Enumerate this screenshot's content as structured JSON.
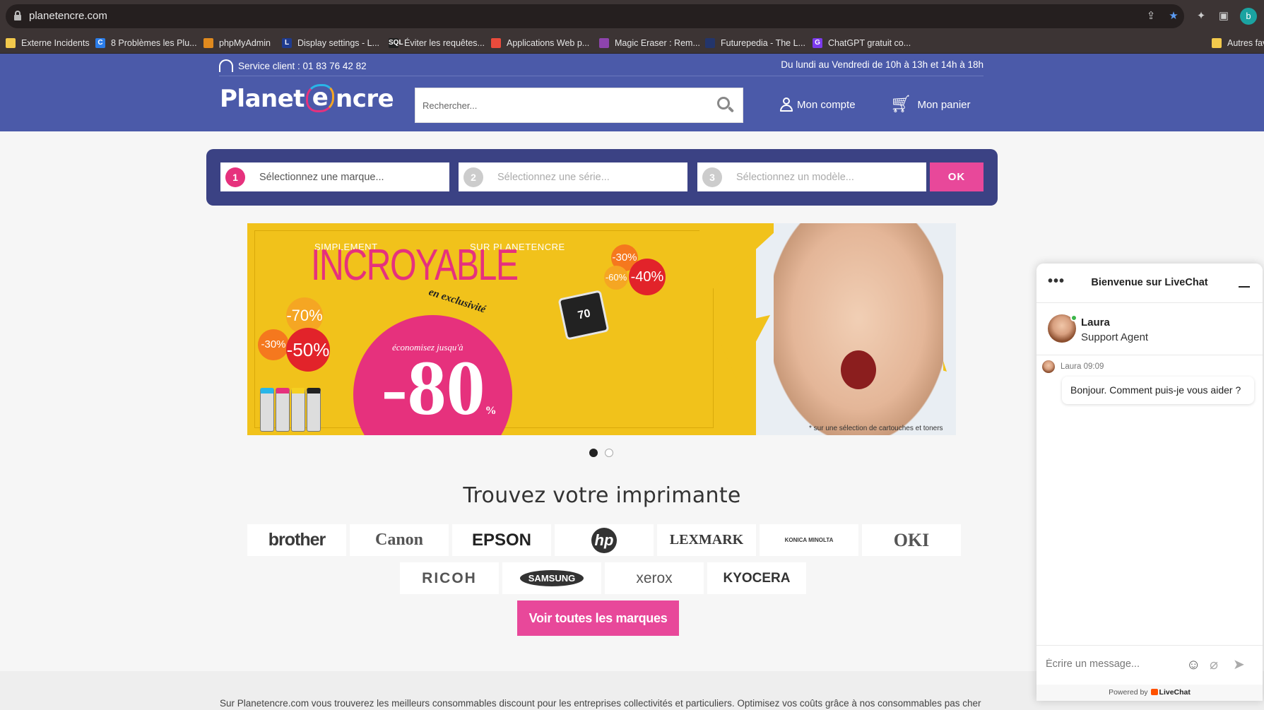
{
  "browser": {
    "url": "planetencre.com",
    "profile_initial": "b",
    "bookmarks": [
      {
        "label": "Externe Incidents",
        "color": "#f2c94c"
      },
      {
        "label": "8 Problèmes les Plu...",
        "color": "#2b7de9"
      },
      {
        "label": "phpMyAdmin",
        "color": "#e08a1e"
      },
      {
        "label": "Display settings - L...",
        "color": "#1f3b8f"
      },
      {
        "label": "Éviter les requêtes...",
        "color": "#222222"
      },
      {
        "label": "Applications Web p...",
        "color": "#e94b3c"
      },
      {
        "label": "Magic Eraser : Rem...",
        "color": "#8e44ad"
      },
      {
        "label": "Futurepedia - The L...",
        "color": "#23356b"
      },
      {
        "label": "ChatGPT gratuit co...",
        "color": "#7c3aed"
      },
      {
        "label": "Autres fav",
        "color": "#f2c94c"
      }
    ],
    "bookmark_icons": [
      "",
      "C",
      "",
      "L",
      "SQL",
      "",
      "",
      "",
      "G",
      ""
    ]
  },
  "header": {
    "service_client": "Service client : 01 83 76 42 82",
    "hours": "Du lundi au Vendredi de 10h à 13h et 14h à 18h",
    "logo_left": "Planet",
    "logo_e": "e",
    "logo_right": "ncre",
    "search_placeholder": "Rechercher...",
    "account_label": "Mon compte",
    "cart_label": "Mon panier",
    "colors": {
      "bg": "#4b5aa9",
      "accent": "#e6317d"
    }
  },
  "finder": {
    "steps": [
      {
        "num": "1",
        "label": "Sélectionnez une marque..."
      },
      {
        "num": "2",
        "label": "Sélectionnez une série..."
      },
      {
        "num": "3",
        "label": "Sélectionnez un modèle..."
      }
    ],
    "ok_label": "OK"
  },
  "banner": {
    "simplement": "SIMPLEMENT",
    "sur_planetencre": "SUR PLANETENCRE",
    "headline": "INCROYABLE",
    "exclusivite": "en exclusivité",
    "economisez": "économisez jusqu'à",
    "big": "-80",
    "asterisk": "*",
    "pct": "%",
    "badges": [
      "-70%",
      "-30%",
      "-50%",
      "-30%",
      "-60%",
      "-40%"
    ],
    "ink_number": "70",
    "footnote": "* sur une sélection de cartouches et toners"
  },
  "carousel": {
    "count": 2,
    "active": 0
  },
  "brands_section": {
    "title": "Trouvez votre imprimante",
    "row1": [
      "brother",
      "Canon",
      "EPSON",
      "hp",
      "LEXMARK",
      "KONICA MINOLTA",
      "OKI"
    ],
    "row2": [
      "RICOH",
      "SAMSUNG",
      "xerox",
      "KYOCERA"
    ],
    "more_label": "Voir toutes les marques"
  },
  "footer": {
    "text": "Sur Planetencre.com vous trouverez les meilleurs consommables discount pour les entreprises collectivités et particuliers. Optimisez vos coûts grâce à nos consommables pas cher"
  },
  "livechat": {
    "title": "Bienvenue sur LiveChat",
    "agent_name": "Laura",
    "agent_role": "Support Agent",
    "meta": "Laura 09:09",
    "message": "Bonjour. Comment puis-je vous aider ?",
    "input_placeholder": "Écrire un message...",
    "powered_prefix": "Powered by",
    "powered_brand": "LiveChat"
  }
}
